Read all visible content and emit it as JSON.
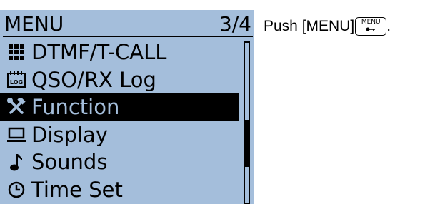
{
  "screen": {
    "title": "MENU",
    "page": "3/4",
    "items": [
      {
        "label": "DTMF/T-CALL",
        "icon": "keypad-grid-icon",
        "selected": false
      },
      {
        "label": "QSO/RX Log",
        "icon": "log-icon",
        "selected": false
      },
      {
        "label": "Function",
        "icon": "tools-icon",
        "selected": true
      },
      {
        "label": "Display",
        "icon": "display-icon",
        "selected": false
      },
      {
        "label": "Sounds",
        "icon": "music-note-icon",
        "selected": false
      },
      {
        "label": "Time Set",
        "icon": "clock-icon",
        "selected": false
      }
    ]
  },
  "instruction": {
    "text": "Push [MENU]",
    "key_label": "MENU",
    "period": "."
  },
  "colors": {
    "lcd_background": "#a4bedb",
    "text": "#000000"
  }
}
